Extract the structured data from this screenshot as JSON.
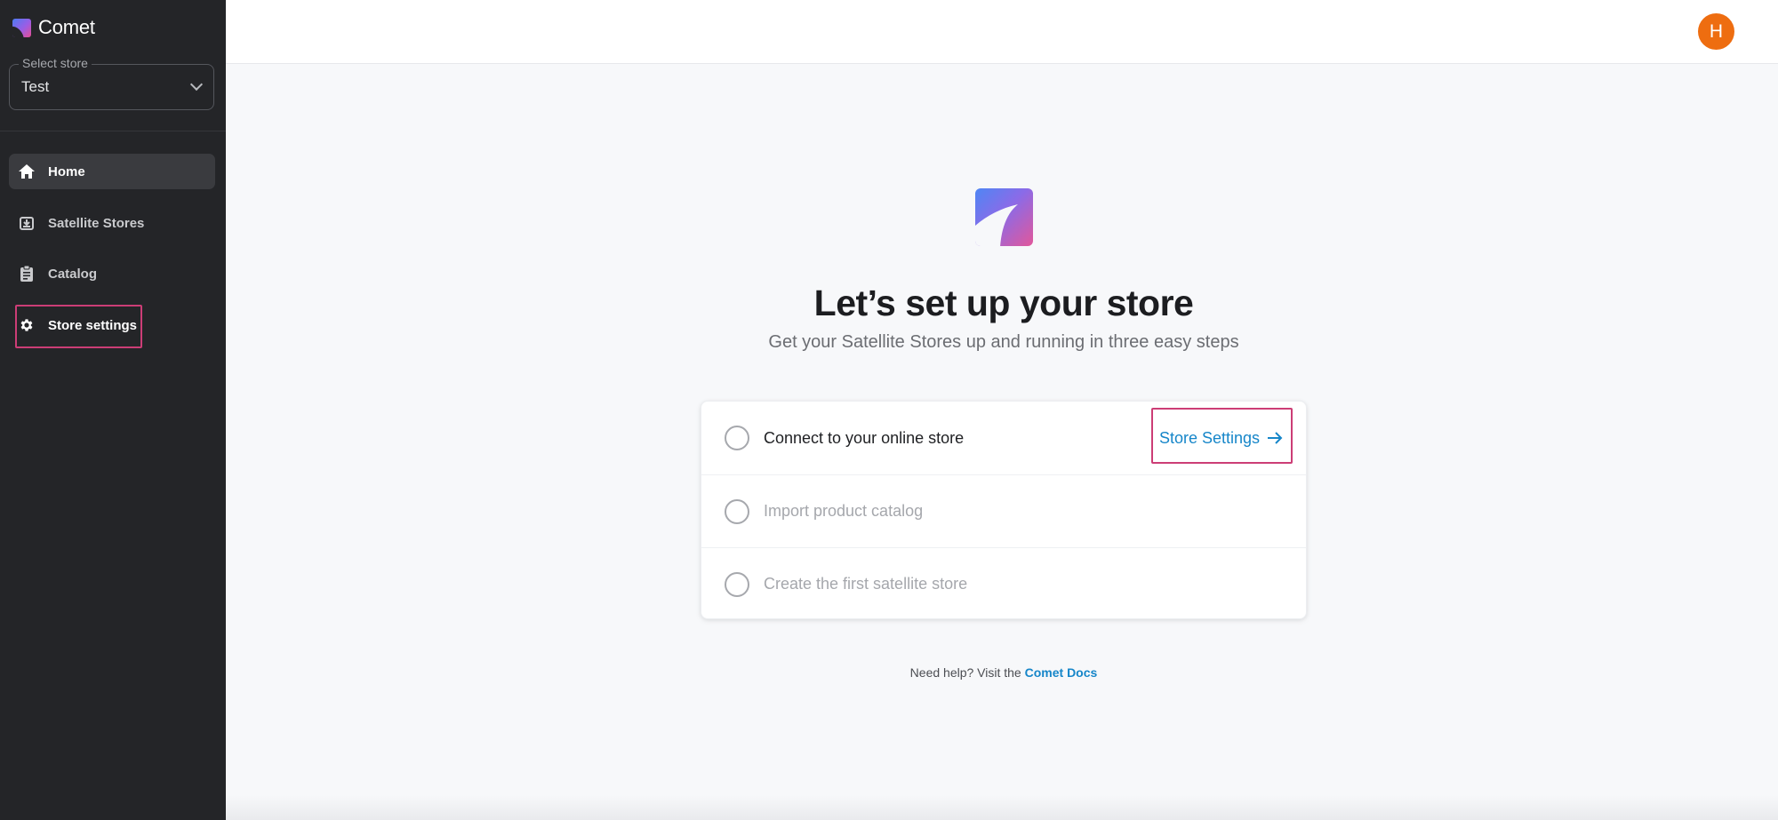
{
  "brand": {
    "name": "Comet"
  },
  "store_select": {
    "legend": "Select store",
    "value": "Test"
  },
  "nav": {
    "items": [
      {
        "label": "Home",
        "icon": "home-icon"
      },
      {
        "label": "Satellite Stores",
        "icon": "satellite-store-icon"
      },
      {
        "label": "Catalog",
        "icon": "clipboard-icon"
      },
      {
        "label": "Store settings",
        "icon": "gear-icon"
      }
    ],
    "active": "Home"
  },
  "user": {
    "avatar_initial": "H",
    "avatar_color": "#ee6d10"
  },
  "main": {
    "title": "Let’s set up your store",
    "subtitle": "Get your Satellite Stores up and running in three easy steps",
    "steps": [
      {
        "label": "Connect to your online store",
        "action": "Store Settings",
        "state": "current"
      },
      {
        "label": "Import product catalog",
        "state": "pending"
      },
      {
        "label": "Create the first satellite store",
        "state": "pending"
      }
    ],
    "help_prefix": "Need help? Visit the",
    "help_link": "Comet Docs"
  },
  "colors": {
    "sidebar_bg": "#242528",
    "accent_link": "#1686c9",
    "highlight": "#cc3d76"
  }
}
